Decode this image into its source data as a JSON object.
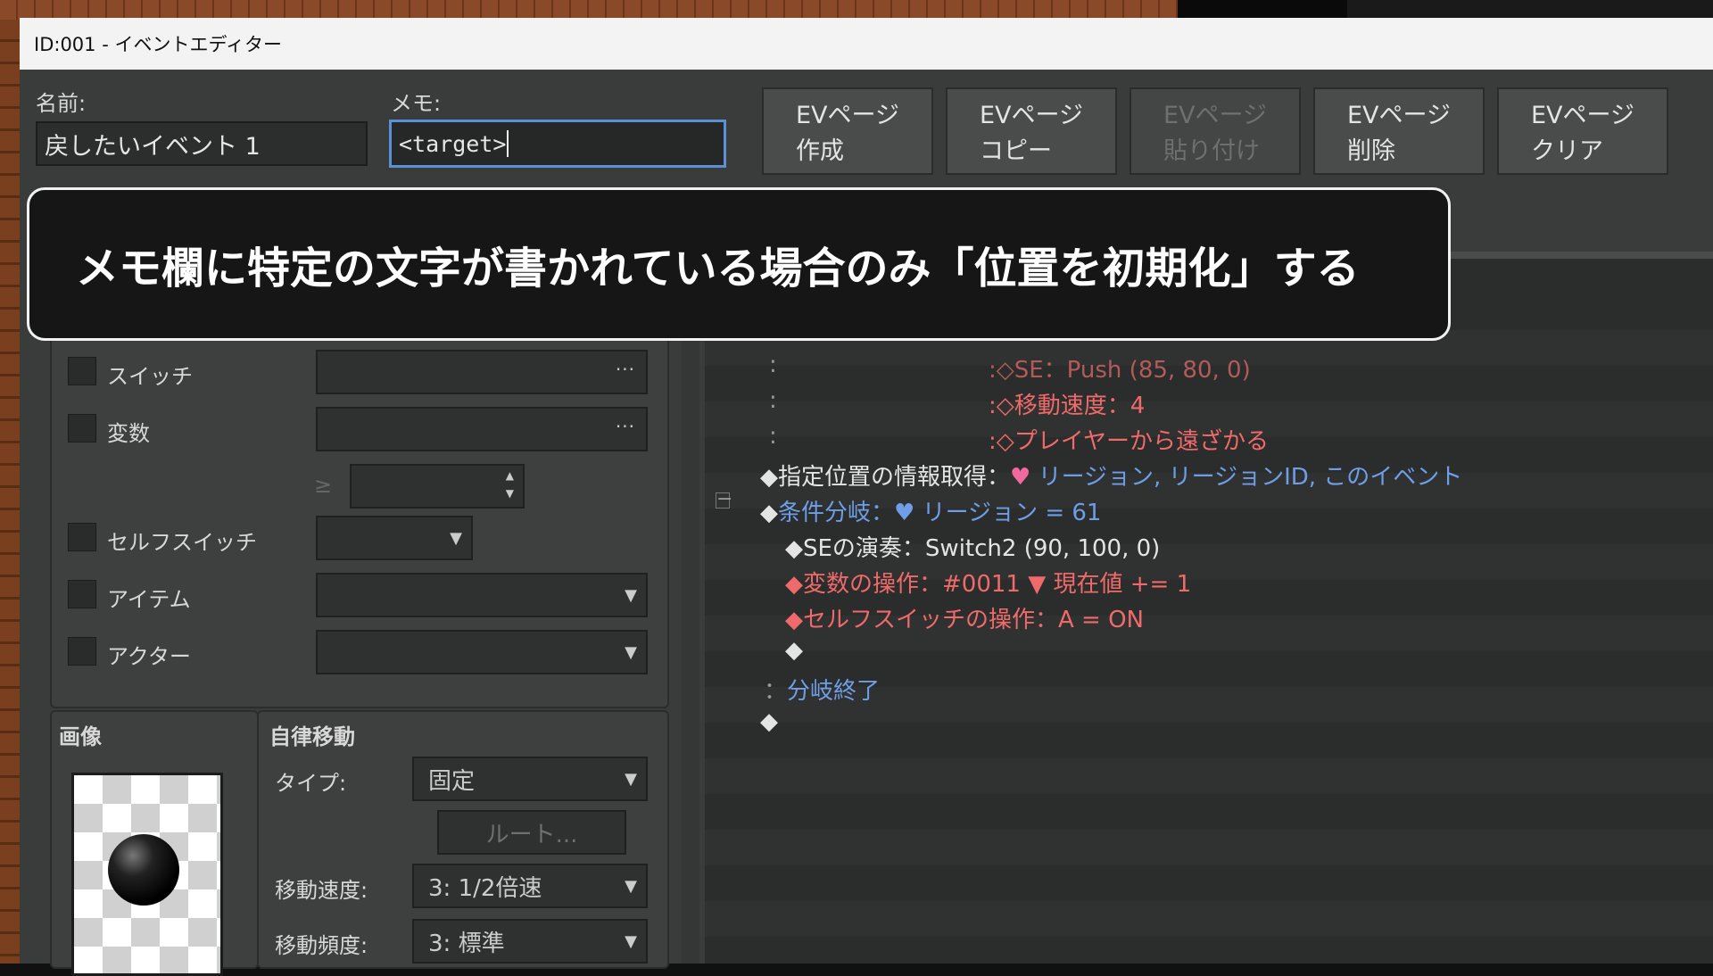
{
  "window": {
    "title": "ID:001 - イベントエディター"
  },
  "name_field": {
    "label": "名前:",
    "value": "戻したいイベント 1"
  },
  "memo_field": {
    "label": "メモ:",
    "value": "<target>"
  },
  "ev_buttons": [
    {
      "line1": "EVページ",
      "line2": "作成",
      "enabled": true
    },
    {
      "line1": "EVページ",
      "line2": "コピー",
      "enabled": true
    },
    {
      "line1": "EVページ",
      "line2": "貼り付け",
      "enabled": false
    },
    {
      "line1": "EVページ",
      "line2": "削除",
      "enabled": true
    },
    {
      "line1": "EVページ",
      "line2": "クリア",
      "enabled": true
    }
  ],
  "overlay_caption": "メモ欄に特定の文字が書かれている場合のみ「位置を初期化」する",
  "conditions": {
    "switch_label": "スイッチ",
    "variable_label": "変数",
    "ge_symbol": "≥",
    "self_switch_label": "セルフスイッチ",
    "item_label": "アイテム",
    "actor_label": "アクター"
  },
  "image_panel": {
    "title": "画像"
  },
  "autonomous_movement": {
    "title": "自律移動",
    "type_label": "タイプ:",
    "type_value": "固定",
    "route_button": "ルート...",
    "speed_label": "移動速度:",
    "speed_value": "3: 1/2倍速",
    "frequency_label": "移動頻度:",
    "frequency_value": "3: 標準"
  },
  "commands": [
    {
      "prefix": ":",
      "text": ":◇SE：Push (85, 80, 0)"
    },
    {
      "prefix": ":",
      "text": ":◇移動速度：4"
    },
    {
      "prefix": ":",
      "text": ":◇プレイヤーから遠ざかる"
    },
    {
      "text": "◆指定位置の情報取得：",
      "icon": "♥",
      "rest": " リージョン, リージョンID, このイベント"
    },
    {
      "text": "◆",
      "blue": "条件分岐：",
      "icon": "♥",
      "rest": " リージョン = 61"
    },
    {
      "text": "◆SEの演奏：Switch2 (90, 100, 0)"
    },
    {
      "text": "◆変数の操作：#0011 ",
      "icon": "▼",
      "rest": " 現在値 += 1"
    },
    {
      "text": "◆セルフスイッチの操作：A = ON"
    },
    {
      "text": "◆"
    },
    {
      "prefix": "：",
      "blue": "分岐終了"
    },
    {
      "text": "◆"
    }
  ],
  "collapse_symbol": "−"
}
